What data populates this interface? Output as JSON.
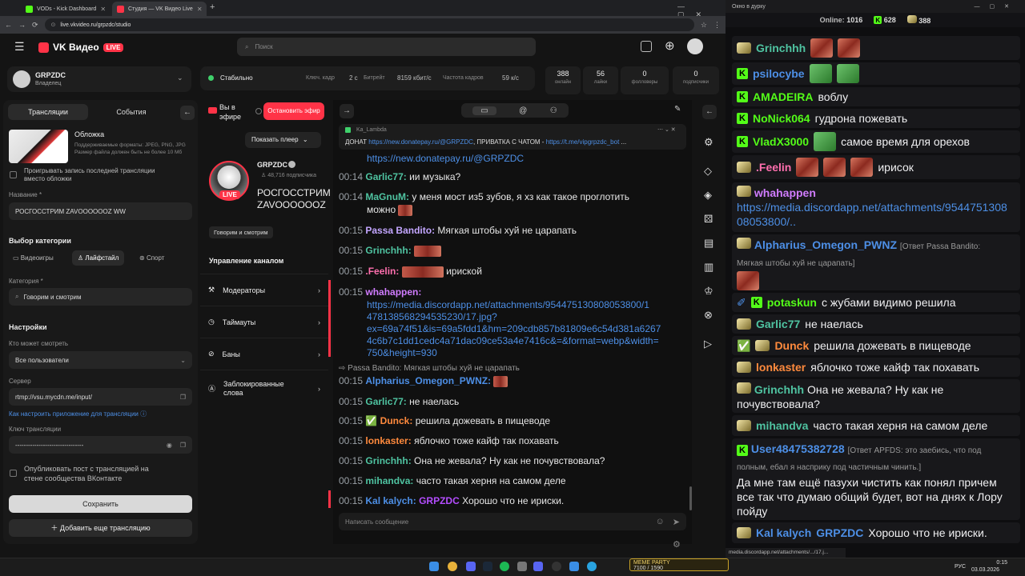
{
  "browser": {
    "tabs": [
      {
        "label": "VODs - Kick Dashboard",
        "fav_color": "#53fc18"
      },
      {
        "label": "Студия — VK Видео Live",
        "fav_color": "#ff3347"
      }
    ],
    "url": "live.vkvideo.ru/grpzdc/studio"
  },
  "vk": {
    "logo": "VK Видео",
    "live_tag": "LIVE",
    "search_placeholder": "Поиск",
    "account": {
      "name": "GRPZDC",
      "role": "Владелец"
    },
    "status": {
      "label": "Стабильно",
      "key_frame_label": "Ключ. кадр",
      "key_frame": "2 с",
      "bitrate_label": "Битрейт",
      "bitrate": "8159 кбит/с",
      "fps_label": "Частота кадров",
      "fps": "59 к/с"
    },
    "stats": [
      {
        "value": "388",
        "label": "онлайн"
      },
      {
        "value": "56",
        "label": "лайки"
      },
      {
        "value": "0",
        "label": "фолловеры"
      },
      {
        "value": "0",
        "label": "подписчики"
      }
    ],
    "left_tabs": [
      "Трансляции",
      "События"
    ],
    "cover": {
      "title": "Обложка",
      "desc": "Поддерживаемые форматы: JPEG, PNG, JPG Размер файла должен быть не более 10 Мб"
    },
    "cover_checkbox": "Проигрывать запись последней трансляции вместо обложки",
    "name_label": "Название *",
    "name_value": "РОСГОССТРИМ ZAVOOOOOOZ WW",
    "category_heading": "Выбор категории",
    "category_tabs": [
      "Видеоигры",
      "Лайфстайл",
      "Спорт"
    ],
    "category_label": "Категория *",
    "category_value": "Говорим и смотрим",
    "settings_heading": "Настройки",
    "who_label": "Кто может смотреть",
    "who_value": "Все пользователи",
    "server_label": "Сервер",
    "server_value": "rtmp://vsu.mycdn.me/input/",
    "app_help": "Как настроить приложение для трансляции",
    "key_label": "Ключ трансляции",
    "key_value": "--------------------------------",
    "publish_checkbox": "Опубликовать пост с трансляцией на стене сообщества ВКонтакте",
    "save": "Сохранить",
    "add_stream": "Добавить еще трансляцию",
    "on_air": "Вы в эфире",
    "stop": "Остановить эфир",
    "show_player": "Показать плеер",
    "channel": {
      "name": "GRPZDC",
      "subs": "48,716 подписчика",
      "title": "РОСГОССТРИМ ZAVOOOOOOZ W",
      "category_tag": "Говорим и смотрим",
      "live": "LIVE"
    },
    "manage_heading": "Управление каналом",
    "manage_items": [
      "Модераторы",
      "Таймауты",
      "Баны",
      "Заблокированные слова"
    ],
    "pinned": {
      "author": "Ka_Lambda",
      "text": "ДОНАТ",
      "link1": "https://new.donatepay.ru/@GRPZDC",
      "mid": ", ПРИВАТКА С ЧАТОМ -",
      "link2": "https://t.me/vipgrpzdc_bot"
    },
    "chat_input": "Написать сообщение",
    "chat": [
      {
        "time": "",
        "nick": "",
        "color": "#4d8fe6",
        "text": "https://new.donatepay.ru/@GRPZDC",
        "link": true
      },
      {
        "time": "00:14",
        "nick": "Garlic77:",
        "color": "#4fc3a1",
        "text": "ии музыка?"
      },
      {
        "time": "00:14",
        "nick": "MaGnuM:",
        "color": "#4fc3a1",
        "text": "у меня мост из5 зубов, я хз как такое проглотить"
      },
      {
        "time": "",
        "nick": "",
        "color": "#e6e6e6",
        "text": "можно"
      },
      {
        "time": "00:15",
        "nick": "Passa Bandito:",
        "color": "#c3a6ff",
        "text": "Мягкая штобы хуй не царапать"
      },
      {
        "time": "00:15",
        "nick": "Grinchhh:",
        "color": "#4fc3a1",
        "text": ""
      },
      {
        "time": "00:15",
        "nick": ".Feelin:",
        "color": "#ff6fae",
        "text": "ириской"
      },
      {
        "time": "00:15",
        "nick": "whahappen:",
        "color": "#d07cff",
        "text": ""
      },
      {
        "time": "",
        "nick": "",
        "color": "#4d8fe6",
        "text": "https://media.discordapp.net/attachments/954475130808053800/1",
        "link": true
      },
      {
        "time": "",
        "nick": "",
        "color": "#4d8fe6",
        "text": "478138568294535230/17.jpg?",
        "link": true
      },
      {
        "time": "",
        "nick": "",
        "color": "#4d8fe6",
        "text": "ex=69a74f51&is=69a5fdd1&hm=209cdb857b81809e6c54d381a6267",
        "link": true
      },
      {
        "time": "",
        "nick": "",
        "color": "#4d8fe6",
        "text": "4c6b7c1dd1cedc4a71dac09ce53a4e7416c&=&format=webp&width=",
        "link": true
      },
      {
        "time": "",
        "nick": "",
        "color": "#4d8fe6",
        "text": "750&height=930",
        "link": true
      }
    ],
    "reply_note": "Passa Bandito: Мягкая штобы хуй не царапать",
    "chat2": [
      {
        "time": "00:15",
        "nick": "Alpharius_Omegon_PWNZ:",
        "color": "#4d8fe6",
        "text": ""
      },
      {
        "time": "00:15",
        "nick": "Garlic77:",
        "color": "#4fc3a1",
        "text": "не наелась"
      },
      {
        "time": "00:15",
        "nick": "Dunck:",
        "color": "#ff8a3d",
        "text": "решила дожевать в пищеводе"
      },
      {
        "time": "00:15",
        "nick": "lonkaster:",
        "color": "#ff8a3d",
        "text": "яблочко тоже кайф так похавать"
      },
      {
        "time": "00:15",
        "nick": "Grinchhh:",
        "color": "#4fc3a1",
        "text": "Она не жевала? Ну как не почувствовала?"
      },
      {
        "time": "00:15",
        "nick": "mihandva:",
        "color": "#4fc3a1",
        "text": "часто такая херня на самом деле"
      },
      {
        "time": "00:15",
        "nick": "Kal kalych:",
        "color": "#4d8fe6",
        "text": "Хорошо что не ириски.",
        "mention": "GRPZDC"
      }
    ]
  },
  "right": {
    "window_title": "Окно в дурку",
    "online_label": "Online:",
    "online": "1016",
    "kick_count": "628",
    "vk_count": "388",
    "messages": [
      {
        "nick": "Grinchhh",
        "color": "#4fc3a1",
        "text": "",
        "badge": "c",
        "emotes": 2
      },
      {
        "nick": "psilocybe",
        "color": "#4d8fe6",
        "text": "",
        "badge": "k",
        "emotes": 2,
        "green": true
      },
      {
        "nick": "AMADEIRA",
        "color": "#53fc18",
        "text": "воблу",
        "badge": "k"
      },
      {
        "nick": "NoNick064",
        "color": "#53fc18",
        "text": "гудрона пожевать",
        "badge": "k"
      },
      {
        "nick": "VladX3000",
        "color": "#53fc18",
        "text": "самое время для орехов",
        "badge": "k",
        "emotes": 1,
        "green": true
      },
      {
        "nick": ".Feelin",
        "color": "#ff6fae",
        "text": "ирисок",
        "badge": "c",
        "emotes": 3
      },
      {
        "nick": "whahappen",
        "color": "#d07cff",
        "text": "",
        "badge": "c"
      },
      {
        "nick": "Alpharius_Omegon_PWNZ",
        "color": "#4d8fe6",
        "text": "[Ответ Passa Bandito:",
        "badge": "c"
      },
      {
        "nick": "potaskun",
        "color": "#53fc18",
        "text": "с жубами видимо решила",
        "badge": "k"
      },
      {
        "nick": "Garlic77",
        "color": "#4fc3a1",
        "text": "не наелась",
        "badge": "c"
      },
      {
        "nick": "Dunck",
        "color": "#ff8a3d",
        "text": "решила дожевать в пищеводе",
        "badge": "c"
      },
      {
        "nick": "lonkaster",
        "color": "#ff8a3d",
        "text": "яблочко тоже кайф так похавать",
        "badge": "c"
      },
      {
        "nick": "Grinchhh",
        "color": "#4fc3a1",
        "text": "Она не жевала? Ну как не",
        "badge": "c"
      },
      {
        "nick": "mihandva",
        "color": "#4fc3a1",
        "text": "часто такая херня на самом деле",
        "badge": "c"
      },
      {
        "nick": "User48475382728",
        "color": "#4d8fe6",
        "text": "[Ответ APFDS: это заебись, что под",
        "badge": "k"
      },
      {
        "nick": "Kal kalych",
        "color": "#4d8fe6",
        "text": "Хорошо что не ириски.",
        "badge": "c",
        "mention": "GRPZDC"
      }
    ],
    "whahappen_link1": "https://media.discordapp.net/attachments/9544751308",
    "whahappen_link2": "08053800/..",
    "alpharius_line2": "Мягкая штобы хуй не царапать]",
    "grinch_line2": "почувствовала?",
    "user_line2": "полным, ебал я насприку под частичным чинить.]",
    "user_msg": "Да мне там ещё пазухи чистить как понял причем все так что думаю общий будет, вот на днях к Лору пойду",
    "status_url": "media.discordapp.net/attachments/.../17.j..."
  },
  "taskbar": {
    "lang": "РУС",
    "time": "0:15",
    "date": "03.03.2026",
    "meme": "MEME PARTY",
    "meme_sub": "7100 / 1590"
  }
}
